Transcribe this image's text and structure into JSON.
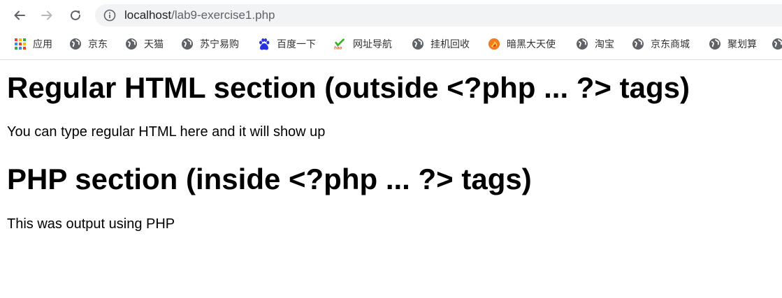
{
  "browser": {
    "url_host": "localhost",
    "url_path": "/lab9-exercise1.php",
    "bookmarks": [
      {
        "label": "应用",
        "icon": "apps-grid-icon"
      },
      {
        "label": "京东",
        "icon": "globe-icon"
      },
      {
        "label": "天猫",
        "icon": "globe-icon"
      },
      {
        "label": "苏宁易购",
        "icon": "globe-icon"
      },
      {
        "label": "百度一下",
        "icon": "baidu-paw-icon"
      },
      {
        "label": "网址导航",
        "icon": "hao-icon"
      },
      {
        "label": "挂机回收",
        "icon": "globe-icon"
      },
      {
        "label": "暗黑大天使",
        "icon": "flame-icon"
      },
      {
        "label": "淘宝",
        "icon": "globe-icon"
      },
      {
        "label": "京东商城",
        "icon": "globe-icon"
      },
      {
        "label": "聚划算",
        "icon": "globe-icon"
      }
    ]
  },
  "page": {
    "heading_html": "Regular HTML section (outside <?php ... ?> tags)",
    "paragraph_html": "You can type regular HTML here and it will show up",
    "heading_php": "PHP section (inside <?php ... ?> tags)",
    "paragraph_php": "This was output using PHP"
  },
  "colors": {
    "omnibox_bg": "#f1f3f4",
    "icon_gray": "#5f6368",
    "text": "#000000"
  }
}
